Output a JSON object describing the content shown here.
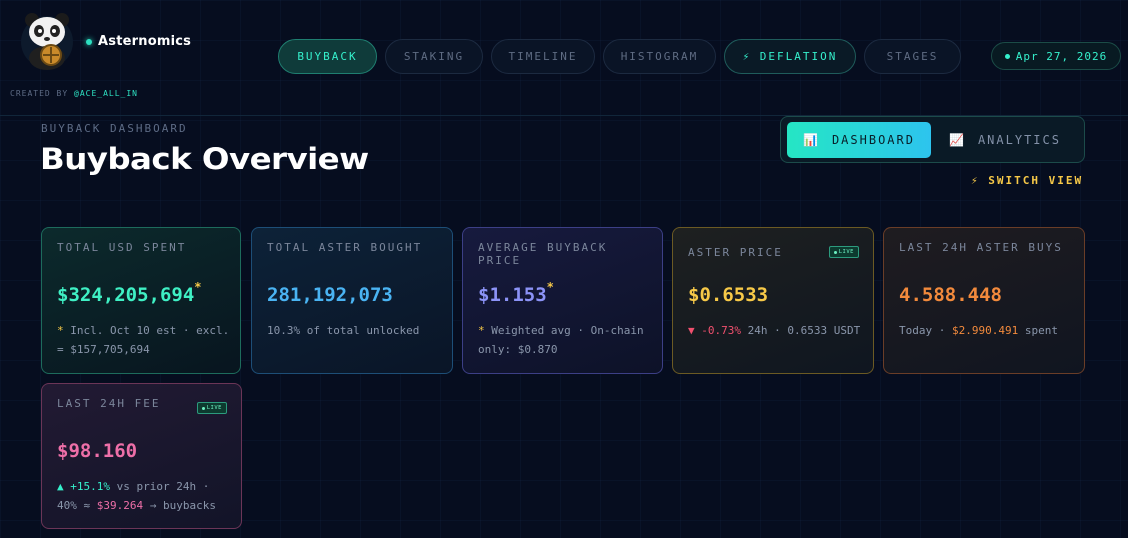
{
  "brand": {
    "name": "Asternomics",
    "credit_prefix": "CREATED BY",
    "credit_handle": "@ACE_ALL_IN"
  },
  "nav": {
    "tabs": [
      {
        "label": "BUYBACK",
        "active": true
      },
      {
        "label": "STAKING",
        "active": false
      },
      {
        "label": "TIMELINE",
        "active": false
      },
      {
        "label": "HISTOGRAM",
        "active": false
      },
      {
        "label": "⚡ DEFLATION",
        "active": false
      },
      {
        "label": "STAGES",
        "active": false
      }
    ],
    "date": "Apr 27, 2026"
  },
  "page": {
    "overline": "BUYBACK DASHBOARD",
    "title": "Buyback Overview"
  },
  "view_toggle": {
    "dashboard_icon": "📊",
    "dashboard_label": "DASHBOARD",
    "analytics_icon": "📈",
    "analytics_label": "ANALYTICS",
    "switch_label": "⚡ SWITCH VIEW"
  },
  "live_label": "LIVE",
  "cards": {
    "usd_spent": {
      "label": "TOTAL USD SPENT",
      "value": "$324,205,694",
      "mark": "*",
      "star": "*",
      "note": " Incl. Oct 10 est · excl. = $157,705,694",
      "color": "#3ff0c4"
    },
    "aster_bought": {
      "label": "TOTAL ASTER BOUGHT",
      "value": "281,192,073",
      "note": "10.3% of total unlocked",
      "color": "#4ab3f2"
    },
    "avg_price": {
      "label": "AVERAGE BUYBACK PRICE",
      "value": "$1.153",
      "mark": "*",
      "star": "*",
      "note": " Weighted avg · On-chain only: $0.870",
      "color": "#8c93f7"
    },
    "aster_price": {
      "label": "ASTER PRICE",
      "value": "$0.6533",
      "change_arrow": "▼",
      "change": "-0.73%",
      "note": " 24h · 0.6533 USDT",
      "color": "#f7c948"
    },
    "last_24h_buys": {
      "label": "LAST 24H ASTER BUYS",
      "value": "4.588.448",
      "note_prefix": "Today · ",
      "spent": "$2.990.491",
      "note_suffix": " spent",
      "color": "#f28a3c"
    },
    "last_24h_fee": {
      "label": "LAST 24H FEE",
      "value": "$98.160",
      "change": "▲ +15.1%",
      "note_mid": " vs prior 24h · 40% ≈ ",
      "buyback": "$39.264",
      "note_suffix": " → buybacks",
      "color": "#ee6fa8"
    }
  }
}
